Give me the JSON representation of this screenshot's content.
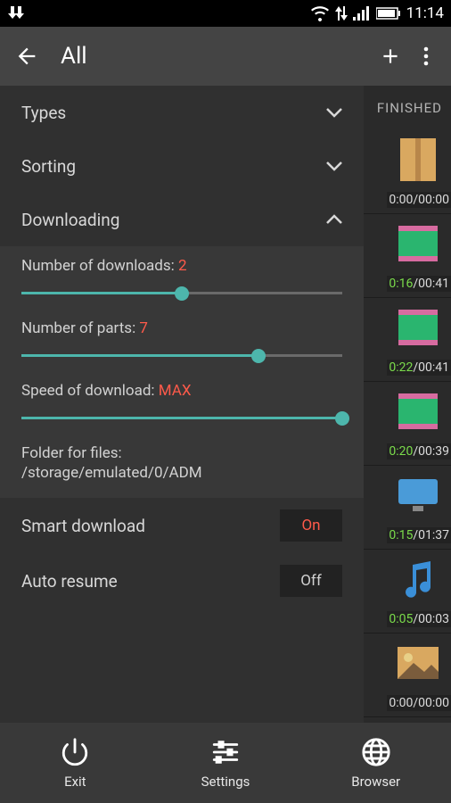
{
  "status": {
    "time": "11:14"
  },
  "toolbar": {
    "title": "All"
  },
  "tabs": {
    "finished": "FINISHED"
  },
  "sections": {
    "types": "Types",
    "sorting": "Sorting",
    "downloading": "Downloading"
  },
  "settings": {
    "numDownloadsLabel": "Number of downloads: ",
    "numDownloadsValue": "2",
    "numDownloadsPercent": 50,
    "numPartsLabel": "Number of parts: ",
    "numPartsValue": "7",
    "numPartsPercent": 74,
    "speedLabel": "Speed of download: ",
    "speedValue": "MAX",
    "speedPercent": 100,
    "folderLabel": "Folder for files:",
    "folderPath": "/storage/emulated/0/ADM",
    "smartDownloadLabel": "Smart download",
    "smartDownloadValue": "On",
    "autoResumeLabel": "Auto resume",
    "autoResumeValue": "Off"
  },
  "nav": {
    "exit": "Exit",
    "settings": "Settings",
    "browser": "Browser"
  },
  "bgItems": [
    {
      "elapsed": "0:00",
      "total": "/00:00",
      "icon": "zip"
    },
    {
      "elapsed": "0:16",
      "total": "/00:41",
      "icon": "video"
    },
    {
      "elapsed": "0:22",
      "total": "/00:41",
      "icon": "video"
    },
    {
      "elapsed": "0:20",
      "total": "/00:39",
      "icon": "video"
    },
    {
      "elapsed": "0:15",
      "total": "/01:37",
      "icon": "monitor"
    },
    {
      "elapsed": "0:05",
      "total": "/00:03",
      "icon": "music"
    },
    {
      "elapsed": "0:00",
      "total": "/00:00",
      "icon": "image"
    },
    {
      "elapsed": "",
      "total": "",
      "icon": "doc"
    }
  ]
}
